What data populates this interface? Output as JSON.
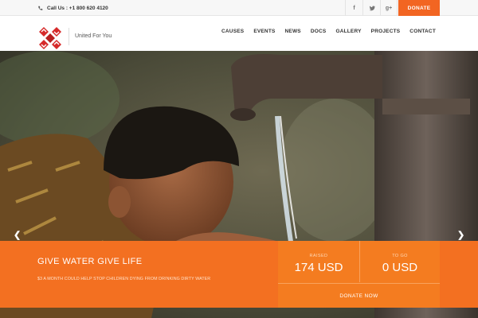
{
  "topbar": {
    "phone": "Call Us : +1 800 620 4120",
    "social": [
      "facebook-icon",
      "twitter-icon",
      "google-plus-icon"
    ],
    "donate_label": "DONATE",
    "accent": "#f26522"
  },
  "header": {
    "tagline": "United For You",
    "nav": [
      "CAUSES",
      "EVENTS",
      "NEWS",
      "DOCS",
      "GALLERY",
      "PROJECTS",
      "CONTACT"
    ]
  },
  "hero": {
    "prev_icon": "chevron-left-icon",
    "next_icon": "chevron-right-icon",
    "campaign": {
      "title": "GIVE WATER GIVE LIFE",
      "text": "$3 A MONTH COULD HELP STOP CHILDREN DYING FROM DRINKING DIRTY WATER",
      "raised_label": "RAISED",
      "raised_value": "174 USD",
      "togo_label": "TO GO",
      "togo_value": "0 USD",
      "donate_label": "DONATE NOW"
    }
  }
}
